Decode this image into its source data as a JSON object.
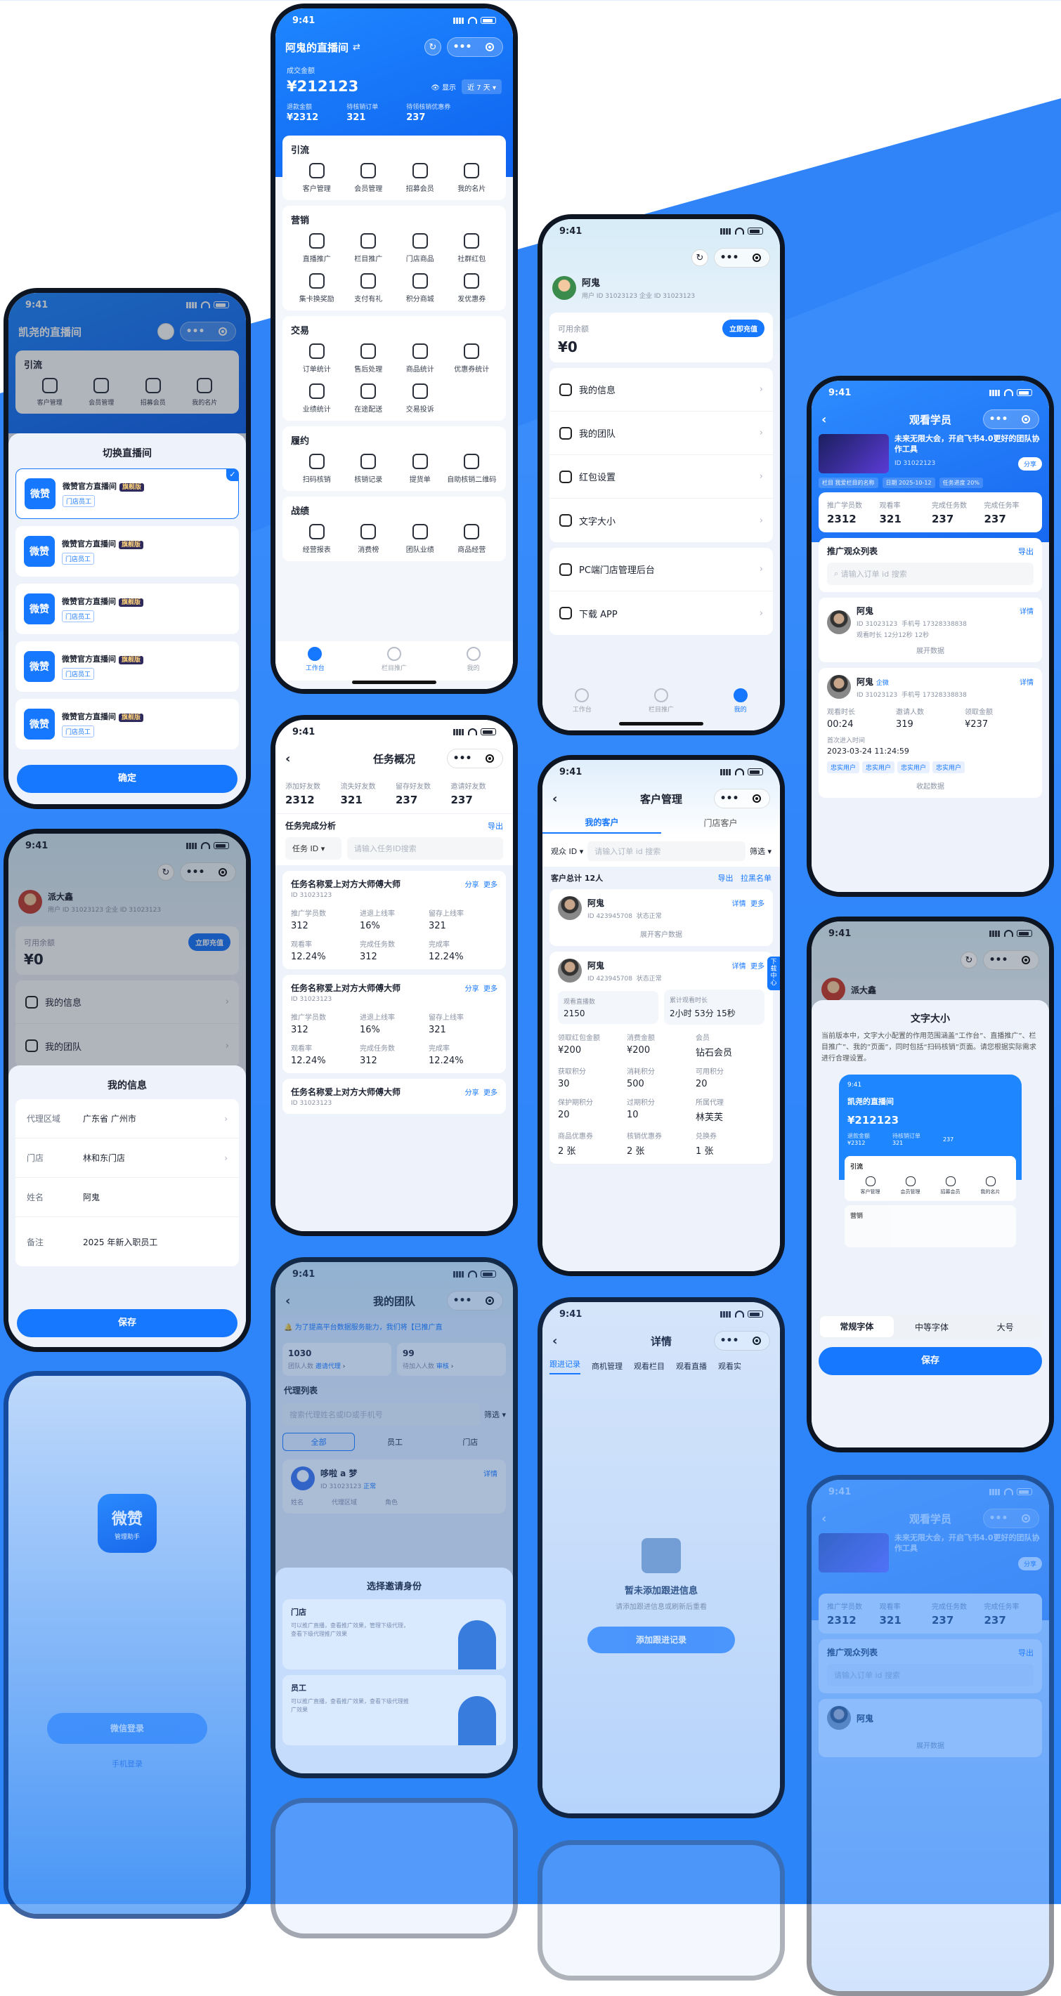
{
  "phone1": {
    "status_time": "9:41",
    "title": "阿鬼的直播间",
    "swap_icon": "⇄",
    "label_total": "成交金额",
    "total": "¥212123",
    "show_label": "显示",
    "period": "近 7 天",
    "stats": [
      {
        "label": "退款金额",
        "value": "¥2312"
      },
      {
        "label": "待核销订单",
        "value": "321"
      },
      {
        "label": "待领核销优惠券",
        "value": "237"
      }
    ],
    "sections": [
      {
        "title": "引流",
        "items": [
          "客户管理",
          "会员管理",
          "招募会员",
          "我的名片"
        ]
      },
      {
        "title": "营销",
        "items": [
          "直播推广",
          "栏目推广",
          "门店商品",
          "社群红包",
          "集卡换奖励",
          "支付有礼",
          "积分商城",
          "发优惠券"
        ]
      },
      {
        "title": "交易",
        "items": [
          "订单统计",
          "售后处理",
          "商品统计",
          "优惠券统计",
          "业绩统计",
          "在途配送",
          "交易投诉"
        ]
      },
      {
        "title": "履约",
        "items": [
          "扫码核销",
          "核销记录",
          "提货单",
          "自助核销二维码"
        ]
      },
      {
        "title": "战绩",
        "items": [
          "经营报表",
          "消费榜",
          "团队业绩",
          "商品经营"
        ]
      }
    ],
    "tabs": [
      "工作台",
      "栏目推广",
      "我的"
    ]
  },
  "phone2": {
    "status_time": "9:41",
    "title": "凯尧的直播间",
    "section": "引流",
    "items": [
      "客户管理",
      "会员管理",
      "招募会员",
      "我的名片"
    ],
    "sheet_title": "切换直播间",
    "shops": [
      {
        "name": "微赞官方直播间",
        "flag": "旗舰版",
        "role": "门店员工"
      },
      {
        "name": "微赞官方直播间",
        "flag": "旗舰版",
        "role": "门店员工"
      },
      {
        "name": "微赞官方直播间",
        "flag": "旗舰版",
        "role": "门店员工"
      },
      {
        "name": "微赞官方直播间",
        "flag": "旗舰版",
        "role": "门店员工"
      },
      {
        "name": "微赞官方直播间",
        "flag": "旗舰版",
        "role": "门店员工"
      }
    ],
    "logo_text": "微赞",
    "confirm": "确定"
  },
  "phone3": {
    "status_time": "9:41",
    "name": "阿鬼",
    "ids": "用户 ID 31023123    企业 ID 31023123",
    "balance_label": "可用余额",
    "balance": "¥0",
    "recharge": "立即充值",
    "menu": [
      "我的信息",
      "我的团队",
      "红包设置",
      "文字大小"
    ],
    "menu2": [
      "PC端门店管理后台",
      "下载 APP"
    ],
    "tabs": [
      "工作台",
      "栏目推广",
      "我的"
    ]
  },
  "phone4": {
    "status_time": "9:41",
    "title": "观看学员",
    "course_title": "未来无限大会，开启飞书4.0更好的团队协作工具",
    "course_id": "ID 31022123",
    "share": "分享",
    "tags": [
      "栏目 我爱栏目的名称",
      "日期 2025-10-12",
      "任务进度 20%"
    ],
    "stats": [
      {
        "label": "推广学员数",
        "value": "2312"
      },
      {
        "label": "观看率",
        "value": "321"
      },
      {
        "label": "完成任务数",
        "value": "237"
      },
      {
        "label": "完成任务率",
        "value": "237"
      }
    ],
    "list_title": "推广观众列表",
    "export": "导出",
    "search_ph": "请输入订单 id 搜索",
    "u1": {
      "name": "阿鬼",
      "id": "ID 31023123",
      "phone": "手机号 17328338838",
      "watch": "观看时长 12分12秒 12秒",
      "detail": "详情",
      "more": "展开数据"
    },
    "u2": {
      "name": "阿鬼",
      "badge": "企微",
      "id": "ID 31023123",
      "phone": "手机号 17328338838",
      "detail": "详情",
      "kv": [
        {
          "l": "观看时长",
          "v": "00:24"
        },
        {
          "l": "邀请人数",
          "v": "319"
        },
        {
          "l": "领取金额",
          "v": "¥237"
        }
      ],
      "first_label": "首次进入时间",
      "first": "2023-03-24 11:24:59",
      "chips": [
        "忠实用户",
        "忠实用户",
        "忠实用户",
        "忠实用户"
      ],
      "less": "收起数据"
    }
  },
  "phone5": {
    "status_time": "9:41",
    "name": "派大鑫",
    "ids": "用户 ID 31023123    企业 ID 31023123",
    "balance_label": "可用余额",
    "balance": "¥0",
    "recharge": "立即充值",
    "menu": [
      "我的信息",
      "我的团队"
    ],
    "sheet_title": "我的信息",
    "fields": [
      {
        "k": "代理区域",
        "v": "广东省 广州市"
      },
      {
        "k": "门店",
        "v": "林和东门店"
      },
      {
        "k": "姓名",
        "v": "阿鬼"
      },
      {
        "k": "备注",
        "v": "2025 年新入职员工"
      }
    ],
    "save": "保存"
  },
  "phone6": {
    "status_time": "9:41",
    "title": "任务概况",
    "stats": [
      {
        "label": "添加好友数",
        "value": "2312"
      },
      {
        "label": "流失好友数",
        "value": "321"
      },
      {
        "label": "留存好友数",
        "value": "237"
      },
      {
        "label": "邀请好友数",
        "value": "237"
      }
    ],
    "analysis": "任务完成分析",
    "export": "导出",
    "filter": "任务 ID",
    "search_ph": "请输入任务ID搜索",
    "tasks": [
      {
        "name": "任务名称爱上对方大师傅大师",
        "id": "ID 31023123",
        "share": "分享",
        "more": "更多",
        "kv": [
          {
            "l": "推广学员数",
            "v": "312"
          },
          {
            "l": "进退上线率",
            "v": "16%"
          },
          {
            "l": "留存上线率",
            "v": "321"
          },
          {
            "l": "观看率",
            "v": "12.24%"
          },
          {
            "l": "完成任务数",
            "v": "312"
          },
          {
            "l": "完成率",
            "v": "12.24%"
          }
        ]
      },
      {
        "name": "任务名称爱上对方大师傅大师",
        "id": "ID 31023123",
        "share": "分享",
        "more": "更多",
        "kv": [
          {
            "l": "推广学员数",
            "v": "312"
          },
          {
            "l": "进退上线率",
            "v": "16%"
          },
          {
            "l": "留存上线率",
            "v": "321"
          },
          {
            "l": "观看率",
            "v": "12.24%"
          },
          {
            "l": "完成任务数",
            "v": "312"
          },
          {
            "l": "完成率",
            "v": "12.24%"
          }
        ]
      },
      {
        "name": "任务名称爱上对方大师傅大师",
        "id": "ID 31023123",
        "share": "分享",
        "more": "更多"
      }
    ]
  },
  "phone7": {
    "status_time": "9:41",
    "title": "客户管理",
    "tabs": [
      "我的客户",
      "门店客户"
    ],
    "filter": "观众 ID",
    "search_ph": "请输入订单 id 搜索",
    "screen": "筛选",
    "total": "客户总计 12人",
    "export": "导出",
    "blacklist": "拉黑名单",
    "side": "下载中心",
    "c1": {
      "name": "阿鬼",
      "id": "ID 423945708",
      "state": "状态正常",
      "detail": "详情",
      "more": "更多",
      "expand": "展开客户数据"
    },
    "c2": {
      "name": "阿鬼",
      "id": "ID 423945708",
      "state": "状态正常",
      "detail": "详情",
      "more": "更多",
      "big": [
        {
          "l": "观看直播数",
          "v": "2150"
        },
        {
          "l": "累计观看时长",
          "v": "2小时 53分 15秒"
        }
      ],
      "kv": [
        {
          "l": "领取红包金额",
          "v": "¥200"
        },
        {
          "l": "消费金额",
          "v": "¥200"
        },
        {
          "l": "会员",
          "v": "钻石会员"
        },
        {
          "l": "获取积分",
          "v": "30"
        },
        {
          "l": "消耗积分",
          "v": "500"
        },
        {
          "l": "可用积分",
          "v": "20"
        },
        {
          "l": "保护期积分",
          "v": "20"
        },
        {
          "l": "过期积分",
          "v": "10"
        },
        {
          "l": "所属代理",
          "v": "林芙芙"
        },
        {
          "l": "商品优惠券",
          "v": "2 张"
        },
        {
          "l": "核销优惠券",
          "v": "2 张"
        },
        {
          "l": "兑换券",
          "v": "1 张"
        }
      ]
    }
  },
  "phone8": {
    "status_time": "9:41",
    "name": "派大鑫",
    "sheet_title": "文字大小",
    "desc": "当前版本中，文字大小配置的作用范围涵盖“工作台”、直播推广”、栏目推广”、我的”页面”，同时包括“扫码核销”页面。请您根据实际需求进行合理设置。",
    "mini_title": "凯尧的直播间",
    "mini_total": "¥212123",
    "mini_stats": [
      {
        "label": "退款金额",
        "value": "¥2312"
      },
      {
        "label": "待核销订单",
        "value": "321"
      },
      {
        "label": "",
        "value": "237"
      }
    ],
    "mini_sec": "引流",
    "mini_items": [
      "客户管理",
      "会员管理",
      "招募会员",
      "我的名片"
    ],
    "mini_sec2": "营销",
    "sizes": [
      "常规字体",
      "中等字体",
      "大号"
    ],
    "save": "保存"
  },
  "phone9": {
    "status_time": "9:41",
    "title": "我的团队",
    "notice": "为了提高平台数据服务能力，我们将【已推广直",
    "stats": [
      {
        "v": "1030",
        "l": "团队人数",
        "link": "邀请代理"
      },
      {
        "v": "99",
        "l": "待加入人数",
        "link": "审核"
      }
    ],
    "list_title": "代理列表",
    "search_ph": "搜索代理姓名或ID或手机号",
    "screen": "筛选",
    "segs": [
      "全部",
      "员工",
      "门店"
    ],
    "member": {
      "name": "哆啦 a 梦",
      "id": "ID 31023123",
      "tag": "正常",
      "detail": "详情"
    },
    "cols": [
      "姓名",
      "代理区域",
      "角色"
    ],
    "sheet_title": "选择邀请身份",
    "opt1": {
      "title": "门店",
      "desc": "可以推广直播，查看推广效果，管理下级代理，查看下级代理推广效果"
    },
    "opt2": {
      "title": "员工",
      "desc": "可以推广直播，查看推广效果，查看下级代理推广效果"
    }
  },
  "phone10": {
    "status_time": "9:41",
    "title": "详情",
    "tabs": [
      "跟进记录",
      "商机管理",
      "观看栏目",
      "观看直播",
      "观看实"
    ],
    "empty_title": "暂未添加跟进信息",
    "empty_desc": "请添加跟进信息或刷新后重看",
    "add": "添加跟进记录"
  },
  "phone11": {
    "logo": "微赞",
    "logo_sub": "管理助手",
    "login": "微信登录",
    "phone_login": "手机登录"
  },
  "phone12": {
    "status_time": "9:41",
    "title": "观看学员",
    "course_title": "未来无限大会，开启飞书4.0更好的团队协作工具",
    "share": "分享",
    "stats": [
      {
        "label": "推广学员数",
        "value": "2312"
      },
      {
        "label": "观看率",
        "value": "321"
      },
      {
        "label": "完成任务数",
        "value": "237"
      },
      {
        "label": "完成任务率",
        "value": "237"
      }
    ],
    "list_title": "推广观众列表",
    "export": "导出",
    "search_ph": "请输入订单 id 搜索",
    "user": "阿鬼",
    "more": "展开数据"
  }
}
